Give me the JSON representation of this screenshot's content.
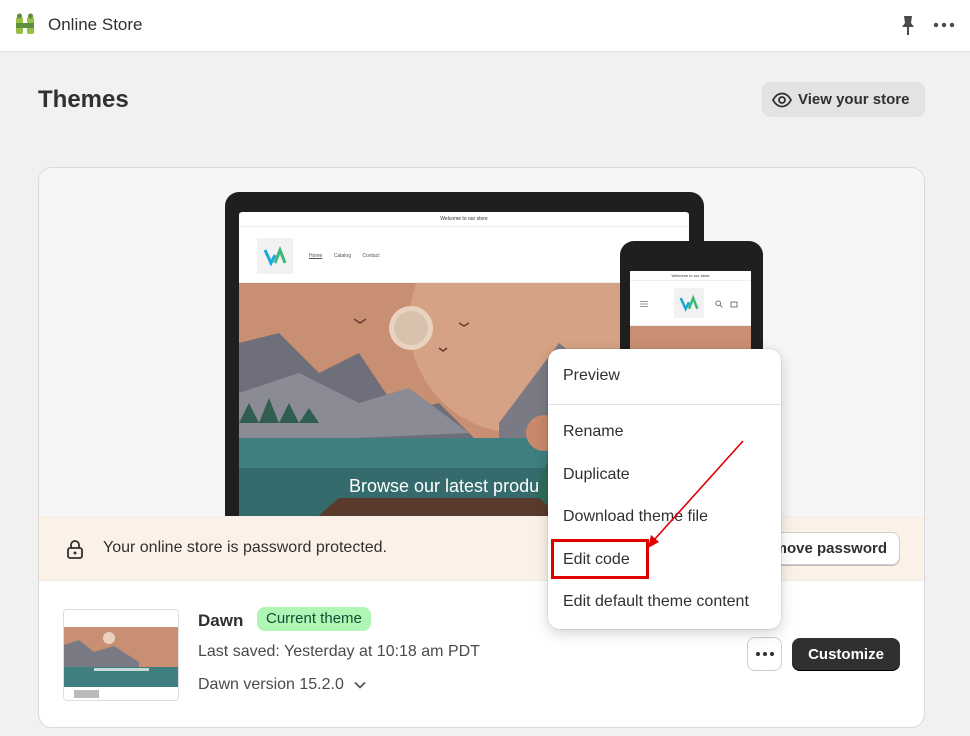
{
  "app": {
    "title": "Online Store",
    "logo_icon": "shopify-bag-icon"
  },
  "topbar": {
    "pin_icon": "pin-icon",
    "more_icon": "more-horizontal-icon"
  },
  "page": {
    "title": "Themes",
    "view_store_label": "View your store"
  },
  "preview": {
    "tablet_announcement": "Welcome to our store",
    "nav": [
      "Home",
      "Catalog",
      "Contact"
    ],
    "hero_text": "Browse our latest produ",
    "phone_announcement": "Welcome to our store"
  },
  "banner": {
    "text": "Your online store is password protected.",
    "button_label": "move password"
  },
  "theme": {
    "name": "Dawn",
    "badge": "Current theme",
    "last_saved": "Last saved: Yesterday at 10:18 am PDT",
    "version": "Dawn version 15.2.0",
    "customize_label": "Customize"
  },
  "menu": {
    "items": [
      "Preview",
      "Rename",
      "Duplicate",
      "Download theme file",
      "Edit code",
      "Edit default theme content"
    ],
    "highlighted": "Edit code"
  },
  "colors": {
    "accent_highlight": "#e00000",
    "badge_bg": "#aff5b4",
    "banner_bg": "#fcf1e6",
    "primary_button": "#303030"
  }
}
